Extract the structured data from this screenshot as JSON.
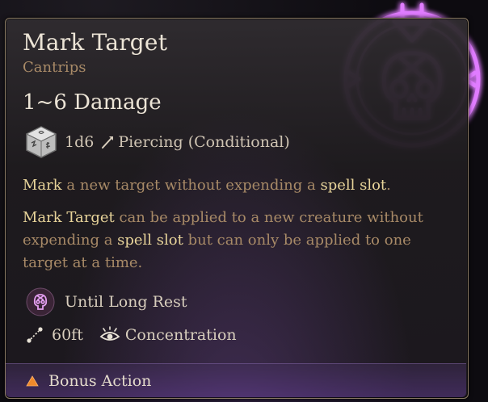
{
  "spell": {
    "title": "Mark Target",
    "category": "Cantrips",
    "damage": "1~6 Damage",
    "dice": "1d6",
    "damage_type": "Piercing (Conditional)",
    "description_1": {
      "hl1": "Mark",
      "t1": " a new target without expending a ",
      "hl2": "spell slot",
      "t2": "."
    },
    "description_2": {
      "hl1": "Mark Target",
      "t1": " can be applied to a new creature without expending a ",
      "hl2": "spell slot",
      "t2": " but can only be applied to one target at a time."
    },
    "duration": "Until Long Rest",
    "range": "60ft",
    "concentration": "Concentration",
    "action": "Bonus Action"
  },
  "colors": {
    "title": "#ece4d6",
    "subtitle": "#a88a67",
    "highlight": "#e8d49a",
    "glow": "#d46bff",
    "action_triangle": "#f08a2a"
  },
  "icons": {
    "spell_icon": "glowing-skull-crosshair-icon",
    "dice": "d6-die-icon",
    "damage_type": "piercing-arrow-icon",
    "duration": "skull-condition-icon",
    "range": "range-icon",
    "concentration": "concentration-eye-icon",
    "action": "bonus-action-triangle-icon"
  }
}
